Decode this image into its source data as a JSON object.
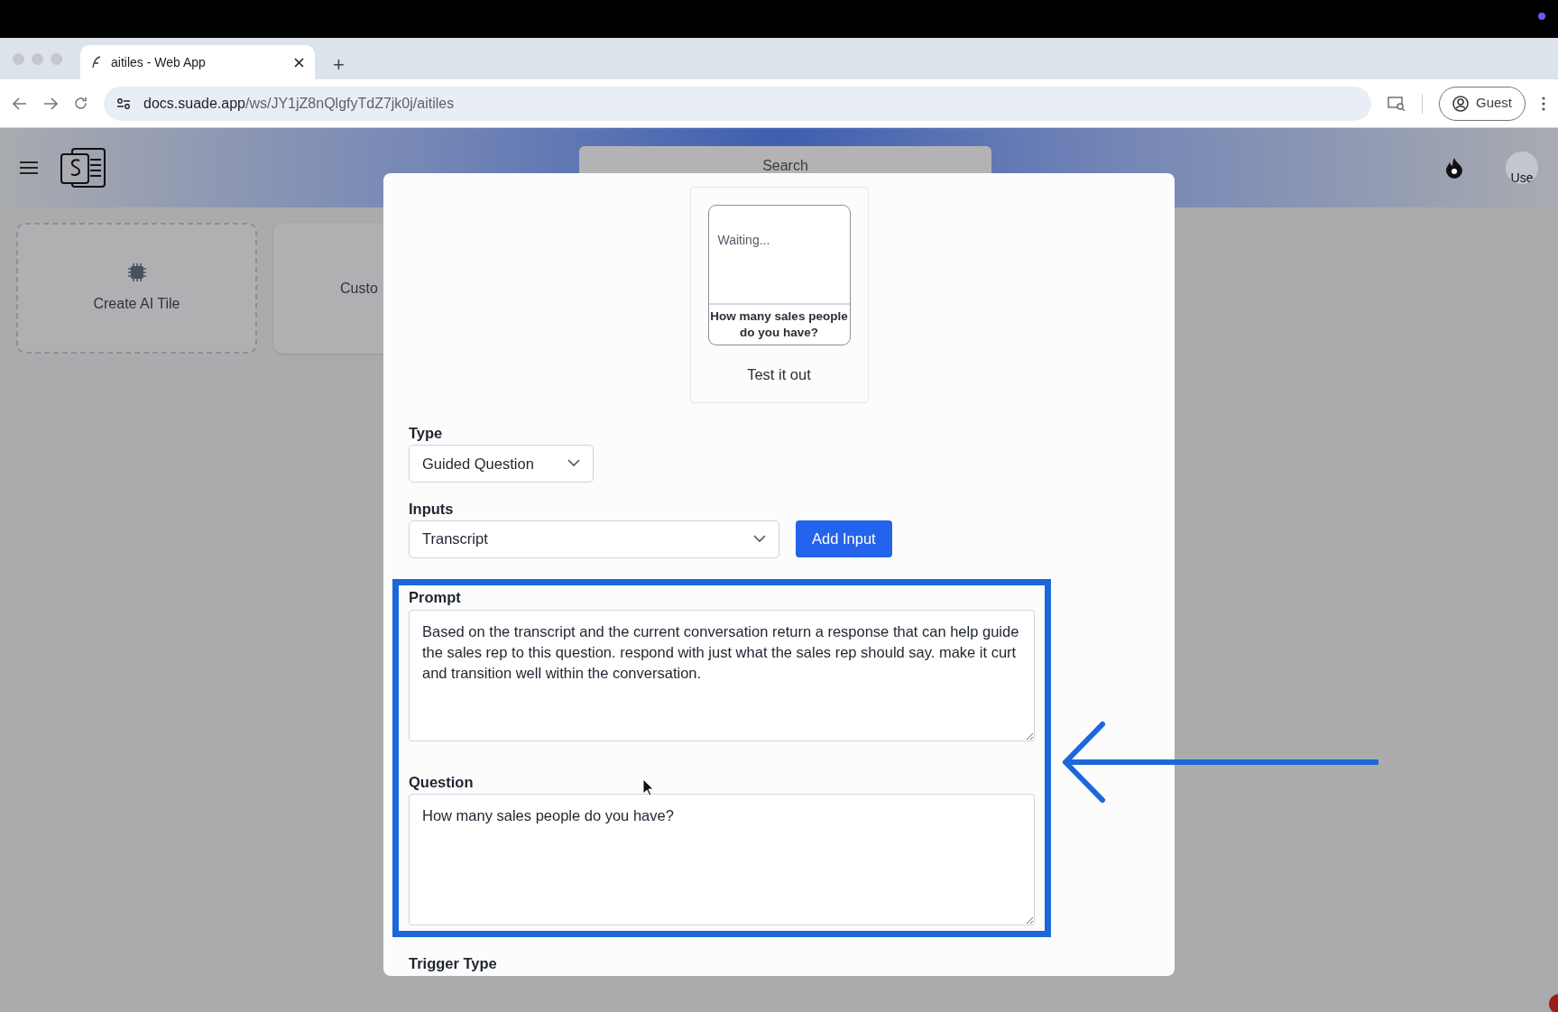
{
  "browser": {
    "tab_title": "aitiles - Web App",
    "new_tab": "+",
    "url_host": "docs.suade.app",
    "url_path": "/ws/JY1jZ8nQlgfyTdZ7jk0j/aitiles",
    "profile": "Guest"
  },
  "header": {
    "search_placeholder": "Search",
    "avatar_alt": "Use"
  },
  "tiles": [
    {
      "kind": "create",
      "label": "Create AI Tile"
    },
    {
      "kind": "custom",
      "label": "Custo"
    }
  ],
  "modal": {
    "preview": {
      "response": "Waiting...",
      "question": "How many sales people do you have?",
      "caption": "Test it out"
    },
    "type": {
      "label": "Type",
      "value": "Guided Question"
    },
    "inputs": {
      "label": "Inputs",
      "value": "Transcript",
      "button": "Add Input"
    },
    "prompt": {
      "label": "Prompt",
      "value": "Based on the transcript and the current conversation return a response that can help guide the sales rep to this question. respond with just what the sales rep should say. make it curt and transition well within the conversation."
    },
    "question": {
      "label": "Question",
      "value": "How many sales people do you have?"
    },
    "trigger_type": {
      "label": "Trigger Type"
    }
  }
}
